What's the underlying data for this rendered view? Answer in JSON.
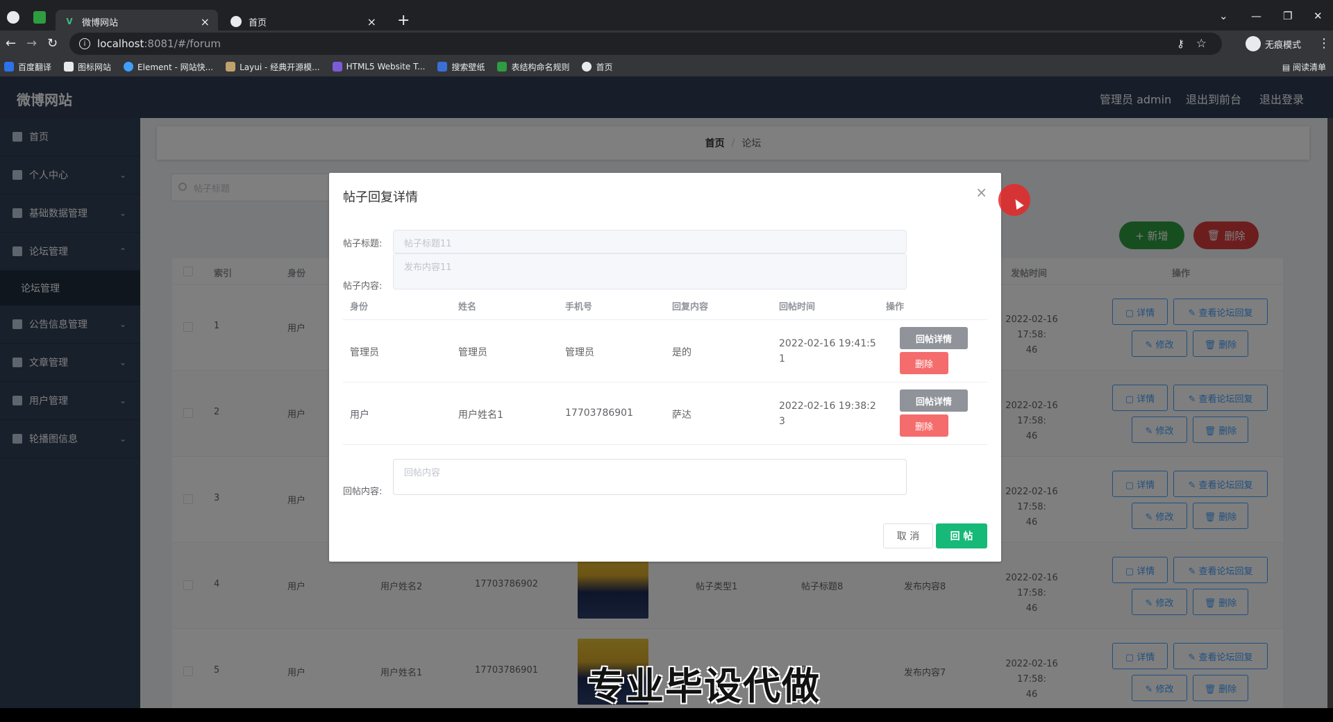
{
  "browser": {
    "tabs": [
      {
        "label": "微博网站",
        "close": "×"
      },
      {
        "label": "首页",
        "close": "×"
      }
    ],
    "new_tab": "+",
    "url_host": "localhost",
    "url_path": ":8081/#/forum",
    "incognito_label": "无痕模式",
    "reading_list": "阅读清单",
    "bookmarks": [
      "百度翻译",
      "图标网站",
      "Element - 网站快...",
      "Layui - 经典开源模...",
      "HTML5 Website T...",
      "搜索壁纸",
      "表结构命名规则",
      "首页"
    ]
  },
  "app": {
    "brand": "微博网站",
    "topnav": [
      "管理员 admin",
      "退出到前台",
      "退出登录"
    ],
    "sidebar": [
      {
        "label": "首页",
        "arrow": ""
      },
      {
        "label": "个人中心",
        "arrow": "⌄"
      },
      {
        "label": "基础数据管理",
        "arrow": "⌄"
      },
      {
        "label": "论坛管理",
        "arrow": "⌃"
      },
      {
        "label": "公告信息管理",
        "arrow": "⌄"
      },
      {
        "label": "文章管理",
        "arrow": "⌄"
      },
      {
        "label": "用户管理",
        "arrow": "⌄"
      },
      {
        "label": "轮播图信息",
        "arrow": "⌄"
      }
    ],
    "sidebar_sub": "论坛管理",
    "breadcrumb": {
      "home": "首页",
      "sep": "/",
      "current": "论坛"
    },
    "search_placeholder": "帖子标题",
    "add_button": "+ 新增",
    "delete_button": "删除",
    "table": {
      "headers": [
        "索引",
        "身份",
        "发帖时间",
        "操作"
      ],
      "rows": [
        {
          "index": "1",
          "identity": "用户",
          "name": "",
          "phone": "",
          "type": "",
          "title": "",
          "content": "",
          "time": "2022-02-16 17:58:\n46"
        },
        {
          "index": "2",
          "identity": "用户",
          "name": "",
          "phone": "",
          "type": "",
          "title": "",
          "content": "",
          "time": "2022-02-16 17:58:\n46"
        },
        {
          "index": "3",
          "identity": "用户",
          "name": "",
          "phone": "",
          "type": "",
          "title": "",
          "content": "",
          "time": "2022-02-16 17:58:\n46"
        },
        {
          "index": "4",
          "identity": "用户",
          "name": "用户姓名2",
          "phone": "17703786902",
          "type": "帖子类型1",
          "title": "帖子标题8",
          "content": "发布内容8",
          "time": "2022-02-16 17:58:\n46"
        },
        {
          "index": "5",
          "identity": "用户",
          "name": "用户姓名1",
          "phone": "17703786901",
          "type": "",
          "title": "7",
          "content": "发布内容7",
          "time": "2022-02-16 17:58:\n46"
        }
      ],
      "ops": {
        "detail": "详情",
        "view_replies": "查看论坛回复",
        "edit": "修改",
        "delete": "删除"
      }
    }
  },
  "dialog": {
    "title": "帖子回复详情",
    "close": "×",
    "title_label": "帖子标题:",
    "title_value": "帖子标题11",
    "content_label": "帖子内容:",
    "content_value": "发布内容11",
    "reply_headers": [
      "身份",
      "姓名",
      "手机号",
      "回复内容",
      "回帖时间",
      "操作"
    ],
    "replies": [
      {
        "identity": "管理员",
        "name": "管理员",
        "phone": "管理员",
        "content": "是的",
        "time": "2022-02-16 19:41:5\n1"
      },
      {
        "identity": "用户",
        "name": "用户姓名1",
        "phone": "17703786901",
        "content": "萨达",
        "time": "2022-02-16 19:38:2\n3"
      }
    ],
    "reply_detail_btn": "回帖详情",
    "reply_delete_btn": "删除",
    "reply_label": "回帖内容:",
    "reply_placeholder": "回帖内容",
    "cancel": "取 消",
    "submit": "回 帖"
  },
  "watermark": "专业毕设代做"
}
